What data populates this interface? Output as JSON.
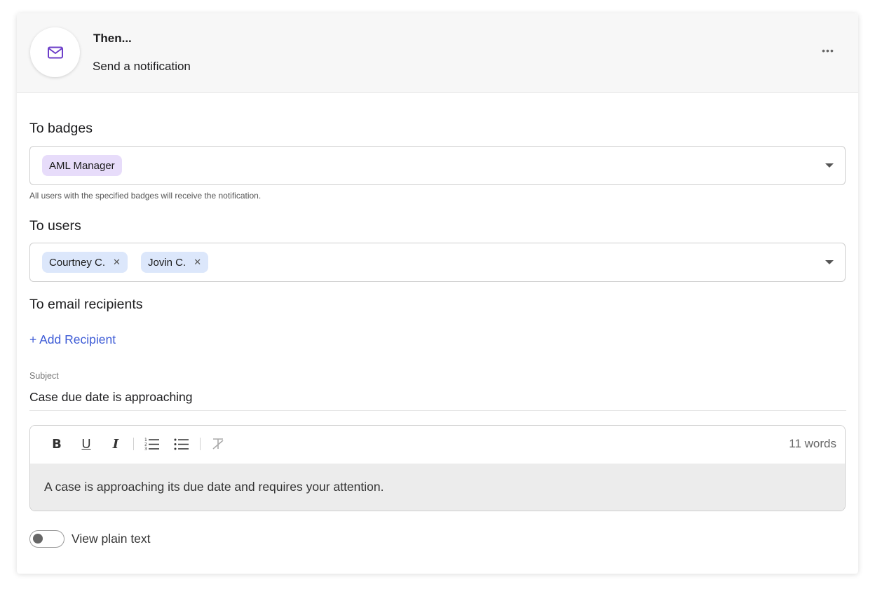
{
  "header": {
    "title": "Then...",
    "subtitle": "Send a notification",
    "icon": "mail-icon",
    "more_label": "•••"
  },
  "badges": {
    "title": "To badges",
    "chips": [
      {
        "label": "AML Manager"
      }
    ],
    "helper": "All users with the specified badges will receive the notification."
  },
  "users": {
    "title": "To users",
    "chips": [
      {
        "label": "Courtney C."
      },
      {
        "label": "Jovin C."
      }
    ],
    "remove_glyph": "✕"
  },
  "email": {
    "title": "To email recipients",
    "add_label": "+ Add Recipient"
  },
  "subject": {
    "label": "Subject",
    "value": "Case due date is approaching"
  },
  "editor": {
    "toolbar": {
      "bold": "B",
      "underline": "U",
      "italic": "I"
    },
    "word_count": "11 words",
    "body": "A case is approaching its due date and requires your attention."
  },
  "toggle": {
    "label": "View plain text",
    "checked": false
  },
  "colors": {
    "accent": "#3d5bd6",
    "icon_purple": "#6d3fc9",
    "badge_chip": "#e7dcfa",
    "user_chip": "#dce7fb"
  }
}
